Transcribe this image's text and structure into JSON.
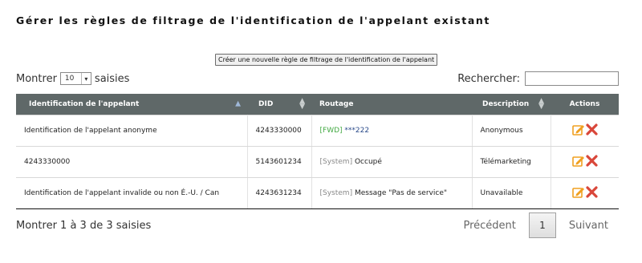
{
  "header": {
    "title": "Gérer les règles de filtrage de l'identification de l'appelant existant"
  },
  "toolbar": {
    "create_label": "Créer une nouvelle règle de filtrage de l'identification de l'appelant"
  },
  "length": {
    "prefix": "Montrer",
    "value": "10",
    "suffix": "saisies"
  },
  "search": {
    "label": "Rechercher:",
    "value": ""
  },
  "table": {
    "columns": [
      "Identification de l'appelant",
      "DID",
      "Routage",
      "Description",
      "Actions"
    ],
    "sorted_column": "Identification de l'appelant",
    "rows": [
      {
        "caller_id": "Identification de l'appelant anonyme",
        "did": "4243330000",
        "route_tag": "[FWD]",
        "route_dest": "***222",
        "description": "Anonymous"
      },
      {
        "caller_id": "4243330000",
        "did": "5143601234",
        "route_tag": "[System]",
        "route_dest": "Occupé",
        "description": "Télémarketing"
      },
      {
        "caller_id": "Identification de l'appelant invalide ou non É.-U. / Can",
        "did": "4243631234",
        "route_tag": "[System]",
        "route_dest": "Message \"Pas de service\"",
        "description": "Unavailable"
      }
    ]
  },
  "footer": {
    "info": "Montrer 1 à 3 de 3 saisies"
  },
  "pagination": {
    "previous": "Précédent",
    "current_page": "1",
    "next": "Suivant"
  },
  "colors": {
    "header_bg": "#5f6868",
    "edit_icon": "#f0a020",
    "delete_icon": "#d9473a",
    "fwd_tag": "#42a942"
  }
}
